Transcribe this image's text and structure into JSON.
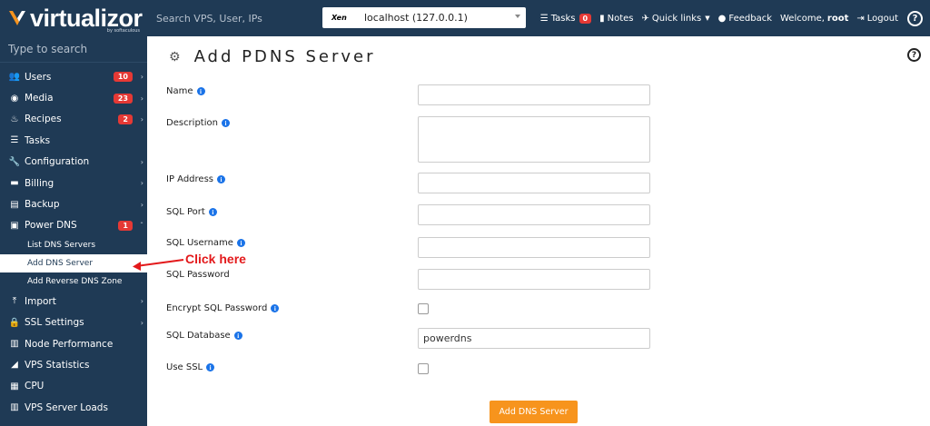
{
  "brand": {
    "name": "virtualizor",
    "sub": "by softaculous"
  },
  "header": {
    "search_placeholder": "Search VPS, User, IPs",
    "server": {
      "logo": "Xen",
      "name": "localhost (127.0.0.1)"
    },
    "nav": {
      "tasks_label": "Tasks",
      "tasks_count": "0",
      "notes_label": "Notes",
      "quicklinks_label": "Quick links",
      "feedback_label": "Feedback",
      "welcome_prefix": "Welcome,",
      "user": "root",
      "logout_label": "Logout",
      "help_glyph": "?"
    }
  },
  "sidebar": {
    "search_placeholder": "Type to search",
    "items": [
      {
        "label": "Users",
        "badge": "10",
        "icon": "users-icon"
      },
      {
        "label": "Media",
        "badge": "23",
        "icon": "media-icon"
      },
      {
        "label": "Recipes",
        "badge": "2",
        "icon": "recipes-icon"
      },
      {
        "label": "Tasks",
        "icon": "tasks-icon"
      },
      {
        "label": "Configuration",
        "icon": "wrench-icon"
      },
      {
        "label": "Billing",
        "icon": "billing-icon"
      },
      {
        "label": "Backup",
        "icon": "backup-icon"
      },
      {
        "label": "Power DNS",
        "badge": "1",
        "icon": "dns-icon"
      },
      {
        "label": "Import",
        "icon": "import-icon"
      },
      {
        "label": "SSL Settings",
        "icon": "lock-icon"
      },
      {
        "label": "Node Performance",
        "icon": "chart-icon"
      },
      {
        "label": "VPS Statistics",
        "icon": "area-chart-icon"
      },
      {
        "label": "CPU",
        "icon": "cpu-icon"
      },
      {
        "label": "VPS Server Loads",
        "icon": "bar-chart-icon"
      }
    ],
    "dns_sub": [
      "List DNS Servers",
      "Add DNS Server",
      "Add Reverse DNS Zone"
    ]
  },
  "page": {
    "title": "Add PDNS Server",
    "help_glyph": "?",
    "fields": {
      "name": {
        "label": "Name",
        "value": ""
      },
      "description": {
        "label": "Description",
        "value": ""
      },
      "ip": {
        "label": "IP Address",
        "value": ""
      },
      "port": {
        "label": "SQL Port",
        "value": ""
      },
      "username": {
        "label": "SQL Username",
        "value": ""
      },
      "password": {
        "label": "SQL Password",
        "value": ""
      },
      "encrypt": {
        "label": "Encrypt SQL Password"
      },
      "database": {
        "label": "SQL Database",
        "value": "powerdns"
      },
      "ssl": {
        "label": "Use SSL"
      }
    },
    "submit_label": "Add DNS Server",
    "info_glyph": "i"
  },
  "annotation": {
    "text": "Click here",
    "color": "#e3191b"
  },
  "colors": {
    "navy": "#1f3a55",
    "accent": "#f7941d",
    "badge": "#e53935",
    "info": "#1a73e8"
  }
}
